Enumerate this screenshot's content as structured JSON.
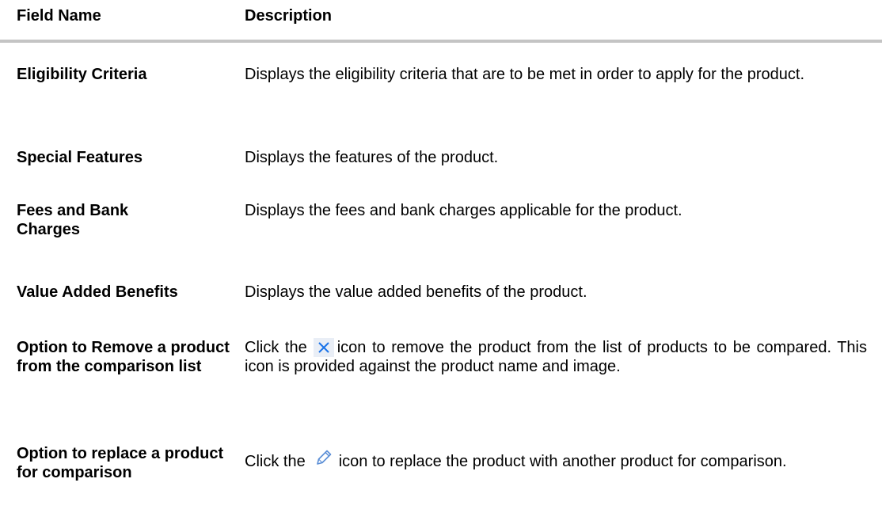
{
  "header": {
    "field_name": "Field Name",
    "description": "Description"
  },
  "rows": [
    {
      "field": "Eligibility Criteria",
      "description": "Displays the eligibility criteria that are to be met in order to apply for the product."
    },
    {
      "field": "Special Features",
      "description": "Displays the features of the product."
    },
    {
      "field": "Fees and Bank Charges",
      "description": "Displays the fees and bank charges applicable for the product."
    },
    {
      "field": "Value Added Benefits",
      "description": "Displays the value added benefits of the product."
    },
    {
      "field": "Option to Remove a product from the comparison list",
      "description_before": "Click the",
      "description_icon": "close-icon",
      "description_after": "icon to remove the product from the list of products to be compared. This icon is provided against the product name and image."
    },
    {
      "field": "Option to replace a product for comparison",
      "description_before": "Click the",
      "description_icon": "pencil-icon",
      "description_after": "icon to replace the product with another product for comparison."
    }
  ],
  "colors": {
    "rule": "#c4c4c4",
    "close_icon": "#1a73e8",
    "close_icon_bg": "#e9eef6",
    "pencil_icon": "#5a8ed6"
  }
}
